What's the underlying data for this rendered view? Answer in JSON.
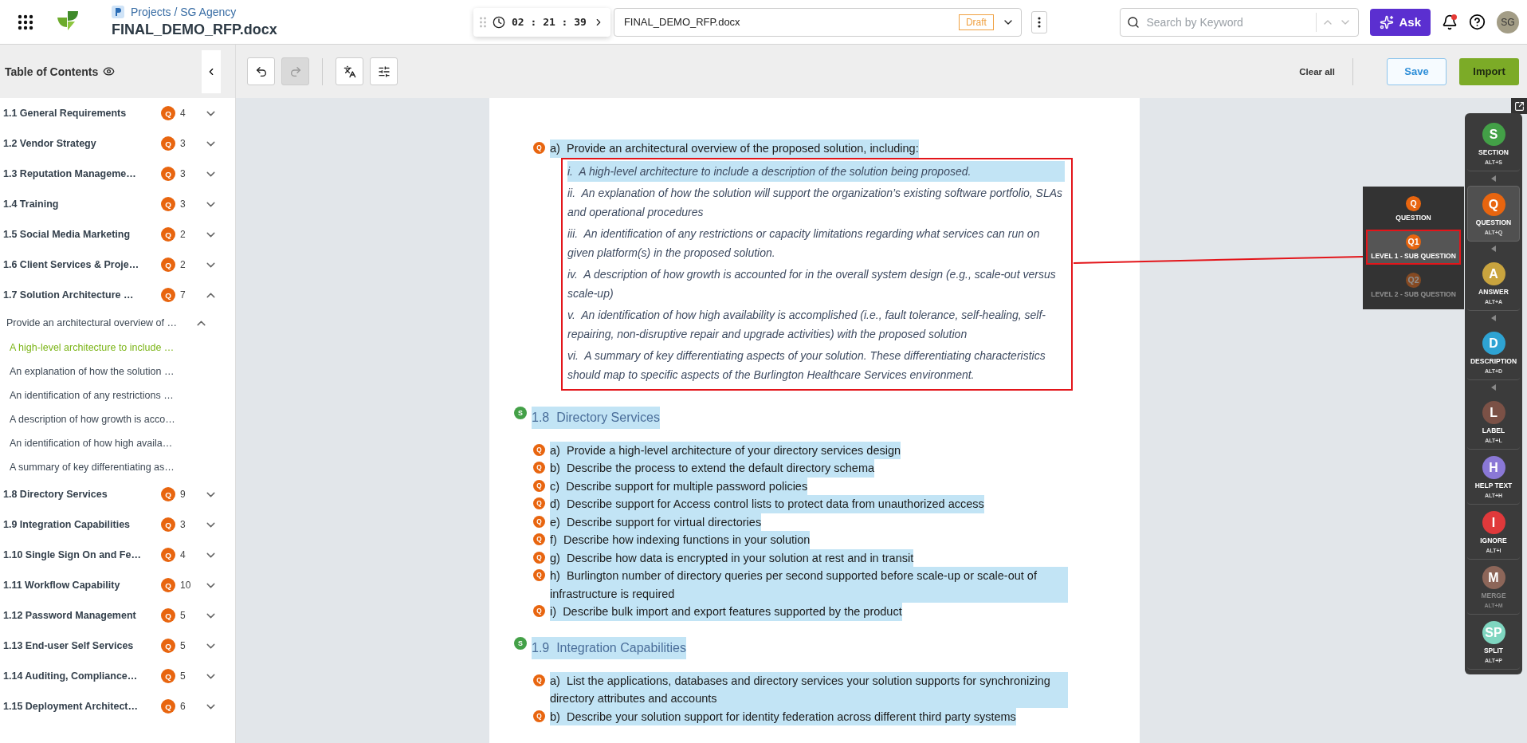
{
  "header": {
    "breadcrumb": "Projects / SG Agency",
    "title": "FINAL_DEMO_RFP.docx",
    "timer": "02 : 21 : 39",
    "document": "FINAL_DEMO_RFP.docx",
    "status": "Draft",
    "search": {
      "placeholder": "Search by Keyword"
    },
    "ask": "Ask",
    "has_notification": true,
    "avatar": "SG"
  },
  "toolbar": {
    "toc_label": "Table of Contents",
    "undo_disabled": false,
    "redo_disabled": true,
    "clear": "Clear all",
    "save": "Save",
    "import": "Import"
  },
  "toc": [
    {
      "label": "1.1 General Requirements",
      "badge": "Q",
      "count": "4",
      "expanded": false
    },
    {
      "label": "1.2 Vendor Strategy",
      "badge": "Q",
      "count": "3",
      "expanded": false
    },
    {
      "label": "1.3 Reputation Manageme…",
      "badge": "Q",
      "count": "3",
      "expanded": false
    },
    {
      "label": "1.4 Training",
      "badge": "Q",
      "count": "3",
      "expanded": false
    },
    {
      "label": "1.5 Social Media Marketing",
      "badge": "Q",
      "count": "2",
      "expanded": false
    },
    {
      "label": "1.6 Client Services & Proje…",
      "badge": "Q",
      "count": "2",
      "expanded": false
    },
    {
      "label": "1.7 Solution Architecture …",
      "badge": "Q",
      "count": "7",
      "expanded": true,
      "children": [
        {
          "label": "Provide an architectural overview of …",
          "expanded": true,
          "children": [
            {
              "label": "A high-level architecture to include …",
              "selected": true
            },
            {
              "label": "An explanation of how the solution …",
              "selected": false
            },
            {
              "label": "An identification of any restrictions …",
              "selected": false
            },
            {
              "label": "A description of how growth is acco…",
              "selected": false
            },
            {
              "label": "An identification of how high availa…",
              "selected": false
            },
            {
              "label": "A summary of key differentiating as…",
              "selected": false
            }
          ]
        }
      ]
    },
    {
      "label": "1.8 Directory Services",
      "badge": "Q",
      "count": "9",
      "expanded": false
    },
    {
      "label": "1.9 Integration Capabilities",
      "badge": "Q",
      "count": "3",
      "expanded": false
    },
    {
      "label": "1.10 Single Sign On and Fe…",
      "badge": "Q",
      "count": "4",
      "expanded": false
    },
    {
      "label": "1.11 Workflow Capability",
      "badge": "Q",
      "count": "10",
      "expanded": false
    },
    {
      "label": "1.12 Password Management",
      "badge": "Q",
      "count": "5",
      "expanded": false
    },
    {
      "label": "1.13 End-user Self Services",
      "badge": "Q",
      "count": "5",
      "expanded": false
    },
    {
      "label": "1.14 Auditing, Compliance…",
      "badge": "Q",
      "count": "5",
      "expanded": false
    },
    {
      "label": "1.15 Deployment Architect…",
      "badge": "Q",
      "count": "6",
      "expanded": false
    }
  ],
  "document": [
    {
      "kind": "question",
      "badge": "Q",
      "label": "a)",
      "text": "Provide an architectural overview of the proposed solution, including:",
      "children": [
        {
          "label": "i.",
          "text": "A high-level architecture to include a description of the solution being proposed.",
          "selected": true
        },
        {
          "label": "ii.",
          "text": "An explanation of how the solution will support the organization’s existing software portfolio, SLAs and operational procedures",
          "selected": false
        },
        {
          "label": "iii.",
          "text": "An identification of any restrictions or capacity limitations regarding what services can run on given platform(s) in the proposed solution.",
          "selected": false
        },
        {
          "label": "iv.",
          "text": "A description of how growth is accounted for in the overall system design (e.g., scale-out versus scale-up)",
          "selected": false
        },
        {
          "label": "v.",
          "text": "An identification of how high availability is accomplished (i.e., fault tolerance, self-healing, self-repairing, non-disruptive repair and upgrade activities) with the proposed solution",
          "selected": false
        },
        {
          "label": "vi.",
          "text": "A summary of key differentiating aspects of your solution. These differentiating characteristics should map to specific aspects of the Burlington Healthcare Services environment.",
          "selected": false
        }
      ]
    },
    {
      "kind": "section",
      "badge": "S",
      "label": "1.8",
      "text": "Directory Services"
    },
    {
      "kind": "question",
      "badge": "Q",
      "label": "a)",
      "text": "Provide a high-level architecture of your directory services design"
    },
    {
      "kind": "question",
      "badge": "Q",
      "label": "b)",
      "text": "Describe the process to extend the default directory schema"
    },
    {
      "kind": "question",
      "badge": "Q",
      "label": "c)",
      "text": "Describe support for multiple password policies"
    },
    {
      "kind": "question",
      "badge": "Q",
      "label": "d)",
      "text": "Describe support for Access control lists to protect data from unauthorized access"
    },
    {
      "kind": "question",
      "badge": "Q",
      "label": "e)",
      "text": "Describe support for virtual directories"
    },
    {
      "kind": "question",
      "badge": "Q",
      "label": "f)",
      "text": "Describe how indexing functions in your solution"
    },
    {
      "kind": "question",
      "badge": "Q",
      "label": "g)",
      "text": "Describe how data is encrypted in your solution at rest and in transit"
    },
    {
      "kind": "question",
      "badge": "Q",
      "label": "h)",
      "text": "Burlington number of directory queries per second supported before scale-up or scale-out of infrastructure is required"
    },
    {
      "kind": "question",
      "badge": "Q",
      "label": "i)",
      "text": "Describe bulk import and export features supported by the product"
    },
    {
      "kind": "section",
      "badge": "S",
      "label": "1.9",
      "text": "Integration Capabilities"
    },
    {
      "kind": "question",
      "badge": "Q",
      "label": "a)",
      "text": "List the applications, databases and directory services your solution supports for synchronizing directory attributes and accounts"
    },
    {
      "kind": "question",
      "badge": "Q",
      "label": "b)",
      "text": "Describe your solution support for identity federation across different third party systems"
    }
  ],
  "tags": [
    {
      "letter": "S",
      "label": "SECTION",
      "shortcut": "ALT+S",
      "color": "#43a047",
      "selected": false,
      "disabled": false,
      "submenu": true
    },
    {
      "letter": "Q",
      "label": "QUESTION",
      "shortcut": "ALT+Q",
      "color": "#e8650f",
      "selected": true,
      "disabled": false,
      "submenu": true
    },
    {
      "letter": "A",
      "label": "ANSWER",
      "shortcut": "ALT+A",
      "color": "#c9a43e",
      "selected": false,
      "disabled": false,
      "submenu": true
    },
    {
      "letter": "D",
      "label": "DESCRIPTION",
      "shortcut": "ALT+D",
      "color": "#2ea3d3",
      "selected": false,
      "disabled": false,
      "submenu": true
    },
    {
      "letter": "L",
      "label": "LABEL",
      "shortcut": "ALT+L",
      "color": "#7b5146",
      "selected": false,
      "disabled": false,
      "submenu": false
    },
    {
      "letter": "H",
      "label": "HELP TEXT",
      "shortcut": "ALT+H",
      "color": "#8a78d6",
      "selected": false,
      "disabled": false,
      "submenu": false
    },
    {
      "letter": "I",
      "label": "IGNORE",
      "shortcut": "ALT+I",
      "color": "#e0393b",
      "selected": false,
      "disabled": false,
      "submenu": false
    },
    {
      "letter": "M",
      "label": "MERGE",
      "shortcut": "ALT+M",
      "color": "#8d6659",
      "selected": false,
      "disabled": true,
      "submenu": false
    },
    {
      "letter": "SP",
      "label": "SPLIT",
      "shortcut": "ALT+P",
      "color": "#7fd6c0",
      "selected": false,
      "disabled": false,
      "submenu": false
    }
  ],
  "submenu": [
    {
      "badge": "Q",
      "label": "QUESTION",
      "selected": false,
      "disabled": false
    },
    {
      "badge": "Q1",
      "label": "LEVEL 1 - SUB QUESTION",
      "selected": true,
      "disabled": false
    },
    {
      "badge": "Q2",
      "label": "LEVEL 2 - SUB QUESTION",
      "selected": false,
      "disabled": true
    }
  ]
}
